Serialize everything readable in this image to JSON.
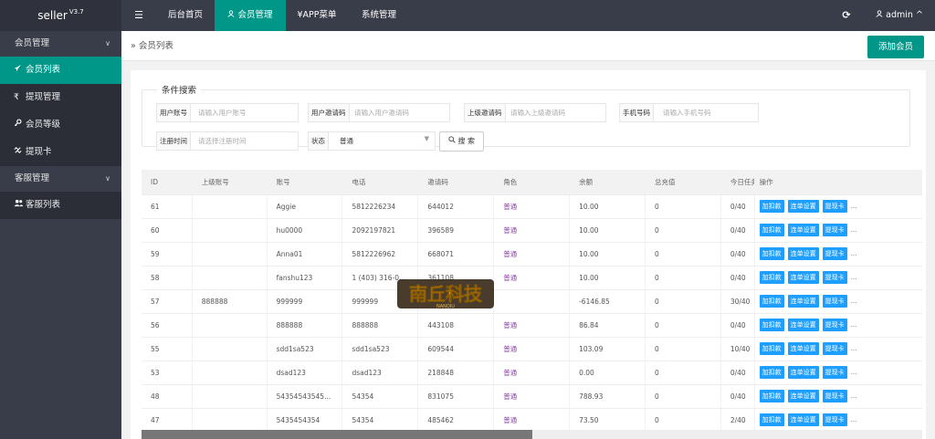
{
  "brand": {
    "name": "seller",
    "version": "V3.7"
  },
  "topbar": {
    "menu_icon": "☰",
    "tabs": [
      {
        "label": "后台首页"
      },
      {
        "label": "会员管理",
        "icon": "user-icon"
      },
      {
        "label": "APP菜单",
        "icon": "yen-icon"
      },
      {
        "label": "系统管理"
      }
    ],
    "refresh_icon": "⟳",
    "user": "admin",
    "user_caret": "^"
  },
  "sidebar": {
    "groups": [
      {
        "label": "会员管理",
        "chevron": "∨",
        "items": [
          {
            "label": "会员列表",
            "icon": "rocket-icon",
            "active": true
          },
          {
            "label": "提现管理",
            "icon": "rupee-icon"
          },
          {
            "label": "会员等级",
            "icon": "key-icon"
          },
          {
            "label": "提现卡",
            "icon": "unlink-icon"
          }
        ]
      },
      {
        "label": "客服管理",
        "chevron": "∨",
        "items": [
          {
            "label": "客服列表",
            "icon": "users-icon"
          }
        ]
      }
    ]
  },
  "breadcrumb": {
    "sep": "»",
    "label": "会员列表"
  },
  "add_button": "添加会员",
  "search": {
    "legend": "条件搜索",
    "fields": [
      {
        "label": "用户账号",
        "placeholder": "请输入用户账号"
      },
      {
        "label": "用户邀请码",
        "placeholder": "请输入用户邀请码"
      },
      {
        "label": "上级邀请码",
        "placeholder": "请输入上级邀请码"
      },
      {
        "label": "手机号码",
        "placeholder": "请输入手机号码"
      },
      {
        "label": "注册时间",
        "placeholder": "请选择注册时间"
      }
    ],
    "status": {
      "label": "状态",
      "value": "普通",
      "caret": "▼"
    },
    "button": "搜 索",
    "button_icon": "search-icon"
  },
  "table": {
    "columns": [
      "ID",
      "上级账号",
      "账号",
      "电话",
      "邀请码",
      "角色",
      "余额",
      "总充值",
      "今日任务",
      "操作"
    ],
    "rows": [
      [
        "61",
        "",
        "Aggie",
        "5812226234",
        "644012",
        "普通",
        "10.00",
        "0",
        "0/40"
      ],
      [
        "60",
        "",
        "hu0000",
        "2092197821",
        "396589",
        "普通",
        "10.00",
        "0",
        "0/40"
      ],
      [
        "59",
        "",
        "Anna01",
        "5812226962",
        "668071",
        "普通",
        "10.00",
        "0",
        "0/40"
      ],
      [
        "58",
        "",
        "fanshu123",
        "1 (403) 316-0...",
        "361108",
        "普通",
        "10.00",
        "0",
        "0/40"
      ],
      [
        "57",
        "888888",
        "999999",
        "999999",
        "",
        "",
        "-6146.85",
        "0",
        "30/40"
      ],
      [
        "56",
        "",
        "888888",
        "888888",
        "443108",
        "普通",
        "86.84",
        "0",
        "0/40"
      ],
      [
        "55",
        "",
        "sdd1sa523",
        "sdd1sa523",
        "609544",
        "普通",
        "103.09",
        "0",
        "10/40"
      ],
      [
        "53",
        "",
        "dsad123",
        "dsad123",
        "218848",
        "普通",
        "0.00",
        "0",
        "0/40"
      ],
      [
        "48",
        "",
        "54354543545...",
        "54354",
        "831075",
        "普通",
        "788.93",
        "0",
        "0/40"
      ],
      [
        "47",
        "",
        "5435454354",
        "54354",
        "485462",
        "普通",
        "73.50",
        "0",
        "2/40"
      ]
    ],
    "ops": [
      "加扣款",
      "连单设置",
      "提现卡"
    ],
    "ops_more": "..."
  },
  "watermark": {
    "text": "南丘科技",
    "sub": "NANQIU"
  },
  "scrollbar": {
    "fraction": 0.5
  },
  "colors": {
    "accent": "#009688",
    "sidebar": "#393d49",
    "op_button": "#1e9fff",
    "role": "#8e44ad"
  }
}
